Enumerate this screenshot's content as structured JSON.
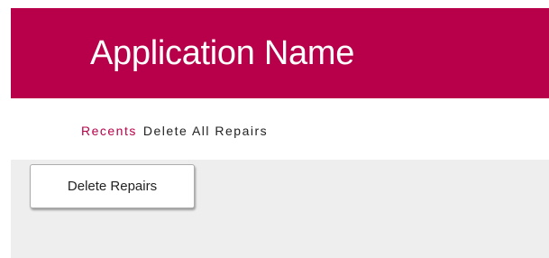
{
  "header": {
    "title": "Application Name",
    "background_color": "#b8004a"
  },
  "nav": {
    "recents_label": "Recents",
    "current_label": "Delete All Repairs",
    "link_color": "#b8004a"
  },
  "main": {
    "delete_button_label": "Delete Repairs",
    "background_color": "#eeeeee"
  }
}
